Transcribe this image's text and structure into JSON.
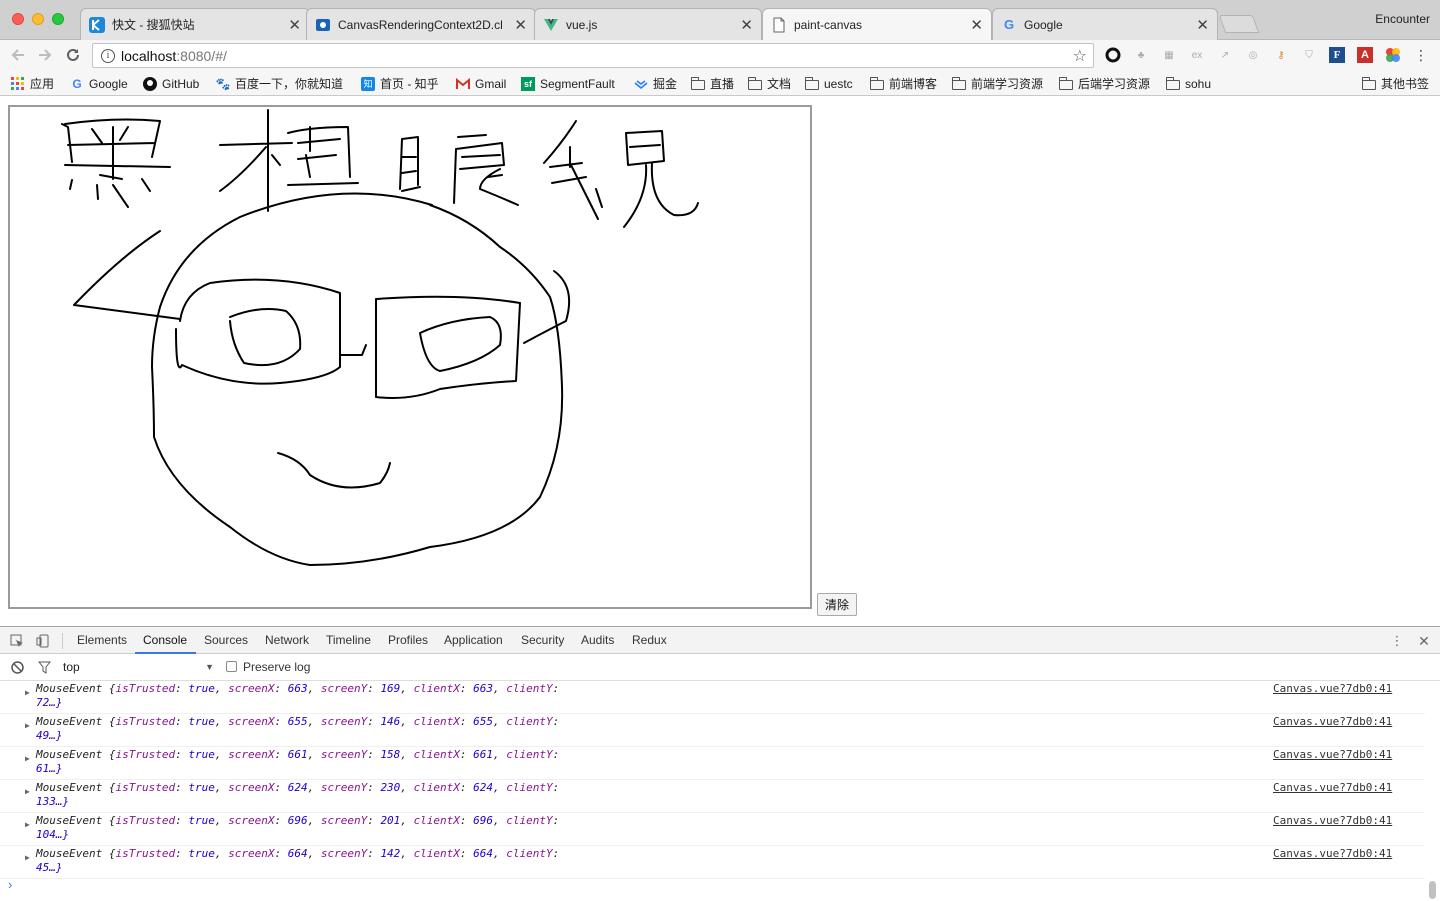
{
  "browser": {
    "profile_name": "Encounter",
    "tabs": [
      {
        "title": "快文 - 搜狐快站",
        "favicon": "kuaizhan-icon",
        "active": false
      },
      {
        "title": "CanvasRenderingContext2D.cl",
        "favicon": "mdn-icon",
        "active": false
      },
      {
        "title": "vue.js",
        "favicon": "vue-icon",
        "active": false
      },
      {
        "title": "paint-canvas",
        "favicon": "page-icon",
        "active": true
      },
      {
        "title": "Google",
        "favicon": "google-icon",
        "active": false
      }
    ],
    "url_host": "localhost",
    "url_rest": ":8080/#/",
    "bookmarks": [
      {
        "label": "应用",
        "icon": "apps-icon"
      },
      {
        "label": "Google",
        "icon": "google-icon"
      },
      {
        "label": "GitHub",
        "icon": "github-icon"
      },
      {
        "label": "百度一下，你就知道",
        "icon": "baidu-icon"
      },
      {
        "label": "首页 - 知乎",
        "icon": "zhihu-icon"
      },
      {
        "label": "Gmail",
        "icon": "gmail-icon"
      },
      {
        "label": "SegmentFault",
        "icon": "segmentfault-icon"
      },
      {
        "label": "掘金",
        "icon": "juejin-icon"
      },
      {
        "label": "直播",
        "icon": "folder-icon"
      },
      {
        "label": "文档",
        "icon": "folder-icon"
      },
      {
        "label": "uestc",
        "icon": "folder-icon"
      },
      {
        "label": "前端博客",
        "icon": "folder-icon"
      },
      {
        "label": "前端学习资源",
        "icon": "folder-icon"
      },
      {
        "label": "后端学习资源",
        "icon": "folder-icon"
      },
      {
        "label": "sohu",
        "icon": "folder-icon"
      }
    ],
    "other_bookmarks": "其他书签"
  },
  "page": {
    "clear_button": "清除"
  },
  "devtools": {
    "tabs": [
      "Elements",
      "Console",
      "Sources",
      "Network",
      "Timeline",
      "Profiles",
      "Application",
      "Security",
      "Audits",
      "Redux"
    ],
    "active_tab": "Console",
    "context": "top",
    "preserve_log_label": "Preserve log",
    "log_entries": [
      {
        "screenX": "663",
        "screenY": "169",
        "clientX": "663",
        "clientY_rest": "72…}",
        "source": "Canvas.vue?7db0:41"
      },
      {
        "screenX": "655",
        "screenY": "146",
        "clientX": "655",
        "clientY_rest": "49…}",
        "source": "Canvas.vue?7db0:41"
      },
      {
        "screenX": "661",
        "screenY": "158",
        "clientX": "661",
        "clientY_rest": "61…}",
        "source": "Canvas.vue?7db0:41"
      },
      {
        "screenX": "624",
        "screenY": "230",
        "clientX": "624",
        "clientY_rest": "133…}",
        "source": "Canvas.vue?7db0:41"
      },
      {
        "screenX": "696",
        "screenY": "201",
        "clientX": "696",
        "clientY_rest": "104…}",
        "source": "Canvas.vue?7db0:41"
      },
      {
        "screenX": "664",
        "screenY": "142",
        "clientX": "664",
        "clientY_rest": "45…}",
        "source": "Canvas.vue?7db0:41"
      }
    ],
    "log_prefix": "MouseEvent {",
    "key_isTrusted": "isTrusted",
    "val_isTrusted": "true",
    "key_screenX": "screenX",
    "key_screenY": "screenY",
    "key_clientX": "clientX",
    "key_clientY": "clientY"
  }
}
